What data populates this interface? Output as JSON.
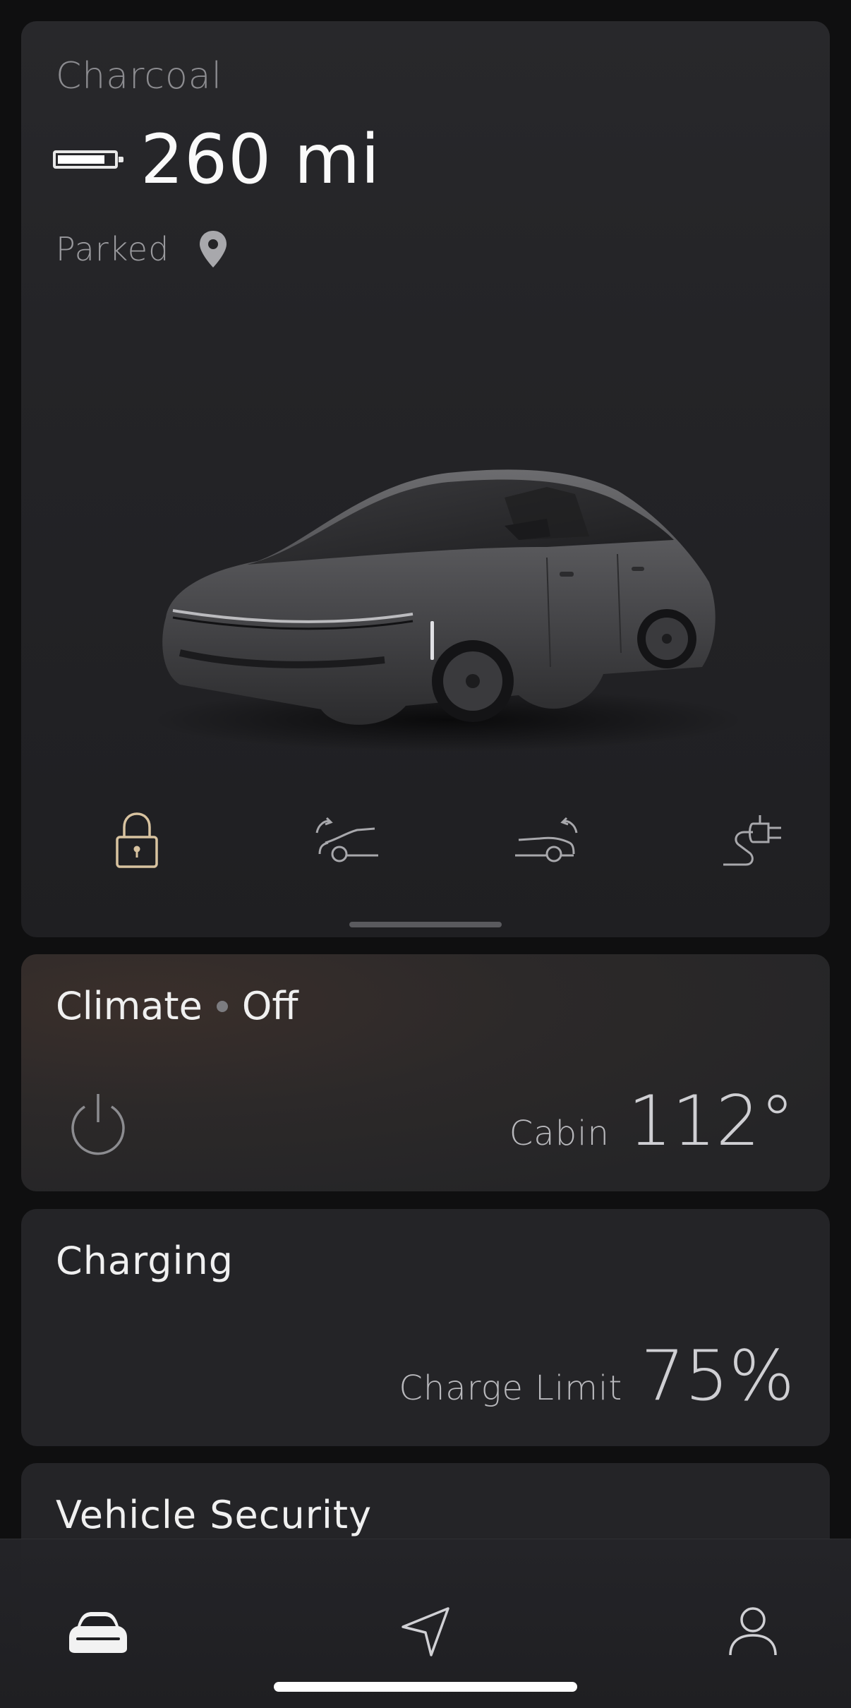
{
  "vehicle": {
    "name": "Charcoal",
    "range": "260 mi",
    "battery_level": 0.85,
    "status": "Parked"
  },
  "quick_actions": [
    {
      "icon": "lock-icon",
      "label": ""
    },
    {
      "icon": "frunk-icon",
      "label": ""
    },
    {
      "icon": "trunk-icon",
      "label": ""
    },
    {
      "icon": "charge-port-icon",
      "label": ""
    }
  ],
  "climate": {
    "title": "Climate",
    "state": "Off",
    "cabin_label": "Cabin",
    "cabin_temp": "112°"
  },
  "charging": {
    "title": "Charging",
    "limit_label": "Charge Limit",
    "limit_value": "75%"
  },
  "security": {
    "title": "Vehicle Security"
  },
  "tabs": [
    {
      "icon": "car-icon",
      "active": true
    },
    {
      "icon": "navigation-icon",
      "active": false
    },
    {
      "icon": "profile-icon",
      "active": false
    }
  ],
  "colors": {
    "background": "#0f0f10",
    "card": "#242427",
    "lock_accent": "#d8c3a0",
    "text": "#f2f2f2",
    "muted": "#8c8c90"
  }
}
